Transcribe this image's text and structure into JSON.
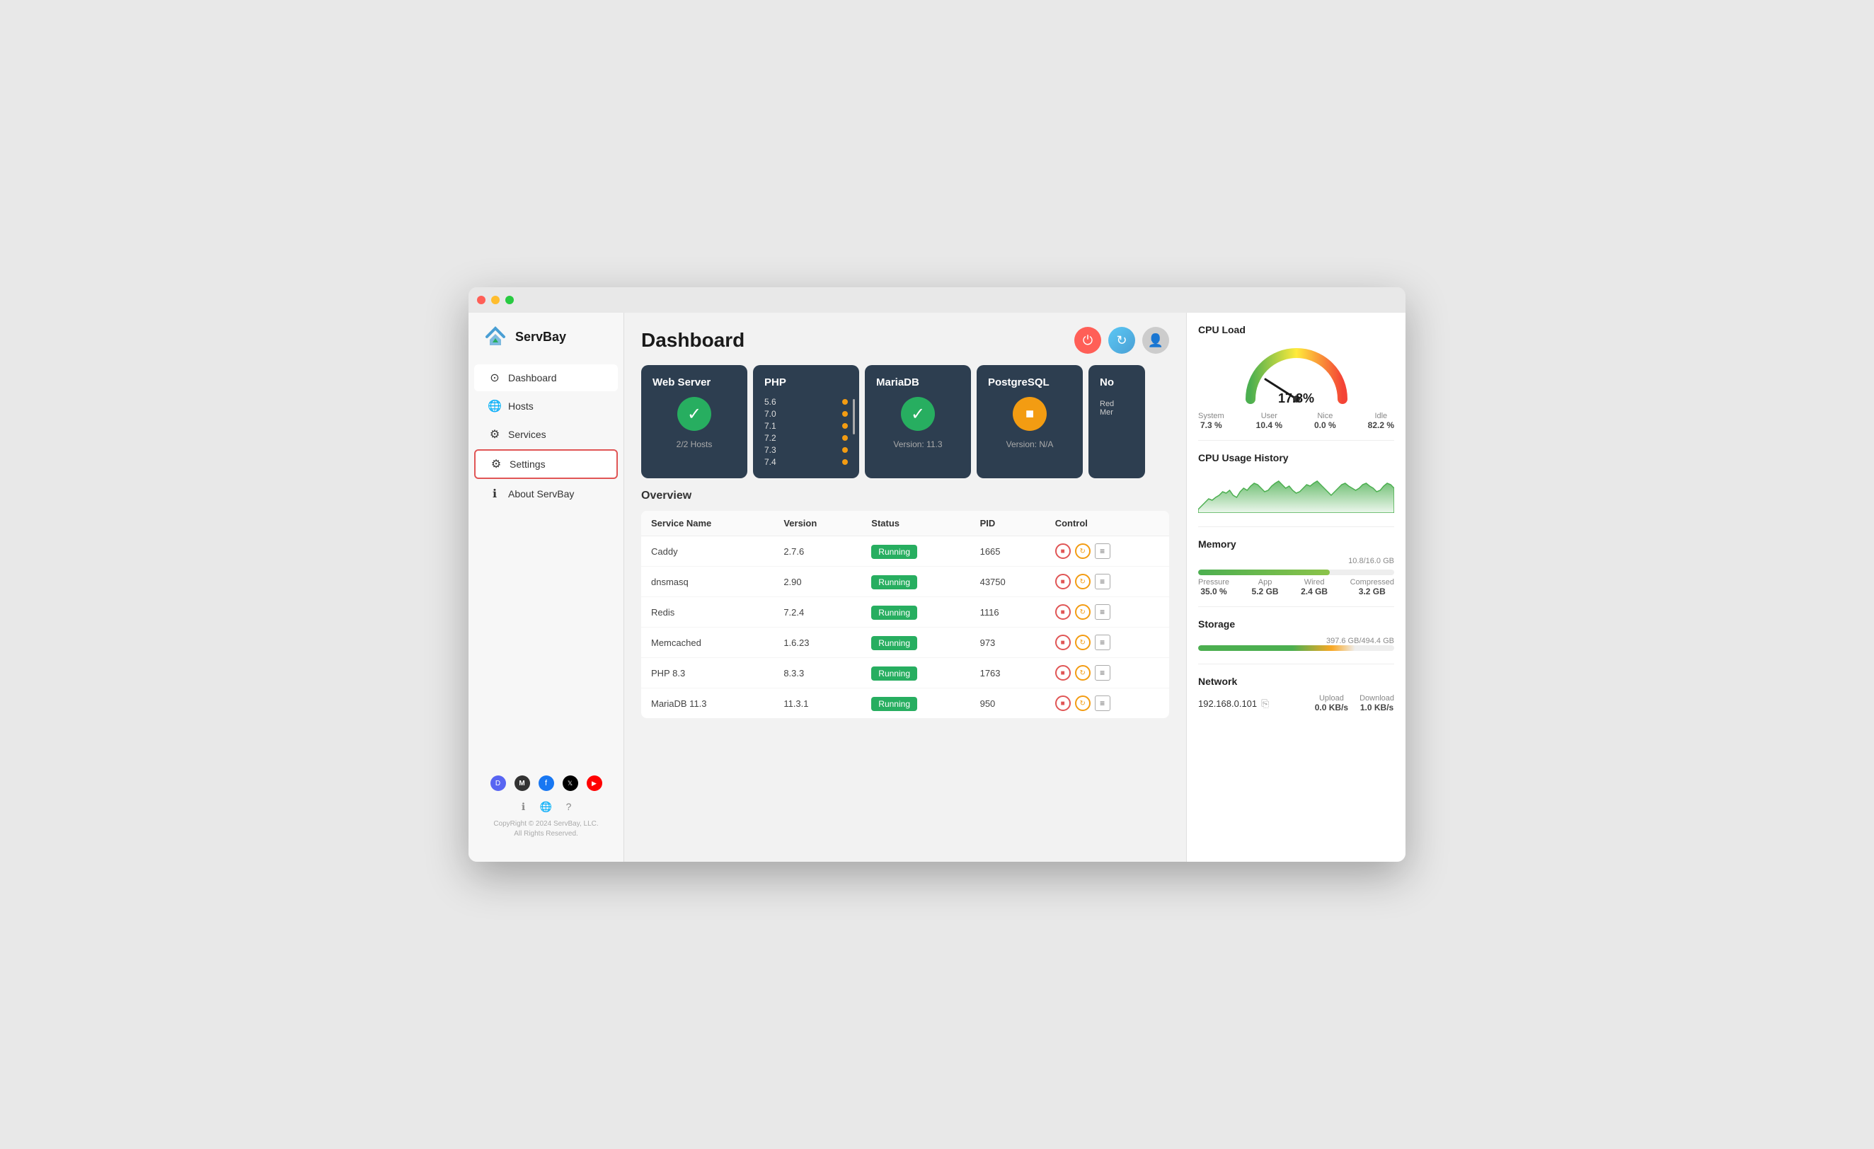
{
  "window": {
    "title": "ServBay"
  },
  "sidebar": {
    "logo": "ServBay",
    "nav": [
      {
        "id": "dashboard",
        "label": "Dashboard",
        "icon": "⊙",
        "active": true,
        "selected": false
      },
      {
        "id": "hosts",
        "label": "Hosts",
        "icon": "🌐",
        "active": false,
        "selected": false
      },
      {
        "id": "services",
        "label": "Services",
        "icon": "⚙",
        "active": false,
        "selected": false
      },
      {
        "id": "settings",
        "label": "Settings",
        "icon": "⚙",
        "active": false,
        "selected": true
      },
      {
        "id": "about",
        "label": "About ServBay",
        "icon": "ℹ",
        "active": false,
        "selected": false
      }
    ],
    "social": [
      {
        "id": "discord",
        "label": "D"
      },
      {
        "id": "medium",
        "label": "M"
      },
      {
        "id": "facebook",
        "label": "f"
      },
      {
        "id": "twitter",
        "label": "𝕏"
      },
      {
        "id": "youtube",
        "label": "▶"
      }
    ],
    "bottom_icons": [
      "ℹ",
      "🌐",
      "?"
    ],
    "copyright": "CopyRight © 2024 ServBay, LLC.\nAll Rights Reserved."
  },
  "header": {
    "title": "Dashboard",
    "power_label": "⏻",
    "refresh_label": "↻",
    "user_label": "👤"
  },
  "service_cards": [
    {
      "id": "webserver",
      "title": "Web Server",
      "status": "running",
      "icon": "check",
      "subtitle": "2/2 Hosts"
    },
    {
      "id": "php",
      "title": "PHP",
      "status": "versions",
      "versions": [
        "5.6",
        "7.0",
        "7.1",
        "7.2",
        "7.3",
        "7.4"
      ]
    },
    {
      "id": "mariadb",
      "title": "MariaDB",
      "status": "running",
      "icon": "check",
      "subtitle": "Version: 11.3"
    },
    {
      "id": "postgresql",
      "title": "PostgreSQL",
      "status": "stopped",
      "icon": "stop",
      "subtitle": "Version: N/A"
    },
    {
      "id": "other",
      "title": "No",
      "status": "mixed",
      "lines": [
        "Red",
        "Mer"
      ]
    }
  ],
  "overview": {
    "title": "Overview",
    "table_headers": [
      "Service Name",
      "Version",
      "Status",
      "PID",
      "Control"
    ],
    "services": [
      {
        "name": "Caddy",
        "version": "2.7.6",
        "status": "Running",
        "pid": "1665"
      },
      {
        "name": "dnsmasq",
        "version": "2.90",
        "status": "Running",
        "pid": "43750"
      },
      {
        "name": "Redis",
        "version": "7.2.4",
        "status": "Running",
        "pid": "1116"
      },
      {
        "name": "Memcached",
        "version": "1.6.23",
        "status": "Running",
        "pid": "973"
      },
      {
        "name": "PHP 8.3",
        "version": "8.3.3",
        "status": "Running",
        "pid": "1763"
      },
      {
        "name": "MariaDB 11.3",
        "version": "11.3.1",
        "status": "Running",
        "pid": "950"
      }
    ]
  },
  "right_panel": {
    "cpu_load": {
      "title": "CPU Load",
      "value": "17.8%",
      "system": "7.3 %",
      "user": "10.4 %",
      "nice": "0.0 %",
      "idle": "82.2 %"
    },
    "cpu_history": {
      "title": "CPU Usage History"
    },
    "memory": {
      "title": "Memory",
      "used": 10.8,
      "total": 16.0,
      "label": "10.8/16.0 GB",
      "percent": 67,
      "pressure": "35.0 %",
      "app": "5.2 GB",
      "wired": "2.4 GB",
      "compressed": "3.2 GB"
    },
    "storage": {
      "title": "Storage",
      "used": "397.6 GB",
      "total": "494.4 GB",
      "label": "397.6 GB/\n494.4 GB",
      "percent": 80
    },
    "network": {
      "title": "Network",
      "ip": "192.168.0.101",
      "upload_label": "Upload",
      "upload_val": "0.0 KB/s",
      "download_label": "Download",
      "download_val": "1.0 KB/s"
    }
  }
}
